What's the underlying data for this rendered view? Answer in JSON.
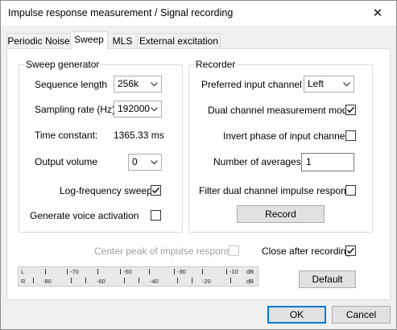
{
  "window": {
    "title": "Impulse response measurement / Signal recording",
    "close_glyph": "✕"
  },
  "tabs": [
    {
      "label": "Periodic Noise"
    },
    {
      "label": "Sweep",
      "active": true
    },
    {
      "label": "MLS"
    },
    {
      "label": "External excitation"
    }
  ],
  "sweep_generator": {
    "title": "Sweep generator",
    "sequence_length": {
      "label": "Sequence length",
      "value": "256k"
    },
    "sampling_rate": {
      "label": "Sampling rate (Hz)",
      "value": "192000"
    },
    "time_constant": {
      "label": "Time constant:",
      "value": "1365.33 ms"
    },
    "output_volume": {
      "label": "Output volume",
      "value": "0"
    },
    "log_frequency_sweep": {
      "label": "Log-frequency sweep",
      "checked": true
    },
    "voice_activation": {
      "label": "Generate voice activation",
      "checked": false
    }
  },
  "recorder": {
    "title": "Recorder",
    "preferred_input": {
      "label": "Preferred input channel",
      "value": "Left"
    },
    "dual_channel": {
      "label": "Dual channel measurement mode",
      "checked": true
    },
    "invert_phase": {
      "label": "Invert phase of input channel",
      "checked": false
    },
    "averages": {
      "label": "Number of averages",
      "value": "1"
    },
    "filter_dual": {
      "label": "Filter dual channel impulse response",
      "checked": false
    },
    "record_button": "Record"
  },
  "center_peak": {
    "label": "Center peak of impulse response",
    "checked": false,
    "enabled": false
  },
  "close_after": {
    "label": "Close after recording",
    "checked": true
  },
  "level_meter": {
    "left_channel": "L",
    "right_channel": "R",
    "left_scale": [
      "-70",
      "-50",
      "-30",
      "-10",
      "dB"
    ],
    "right_scale": [
      "-80",
      "-60",
      "-40",
      "-20",
      "dB"
    ]
  },
  "buttons": {
    "default": "Default",
    "ok": "OK",
    "cancel": "Cancel"
  },
  "colors": {
    "accent": "#0078d7",
    "dialog_bg": "#f0f0f0",
    "panel_bg": "#ffffff"
  }
}
